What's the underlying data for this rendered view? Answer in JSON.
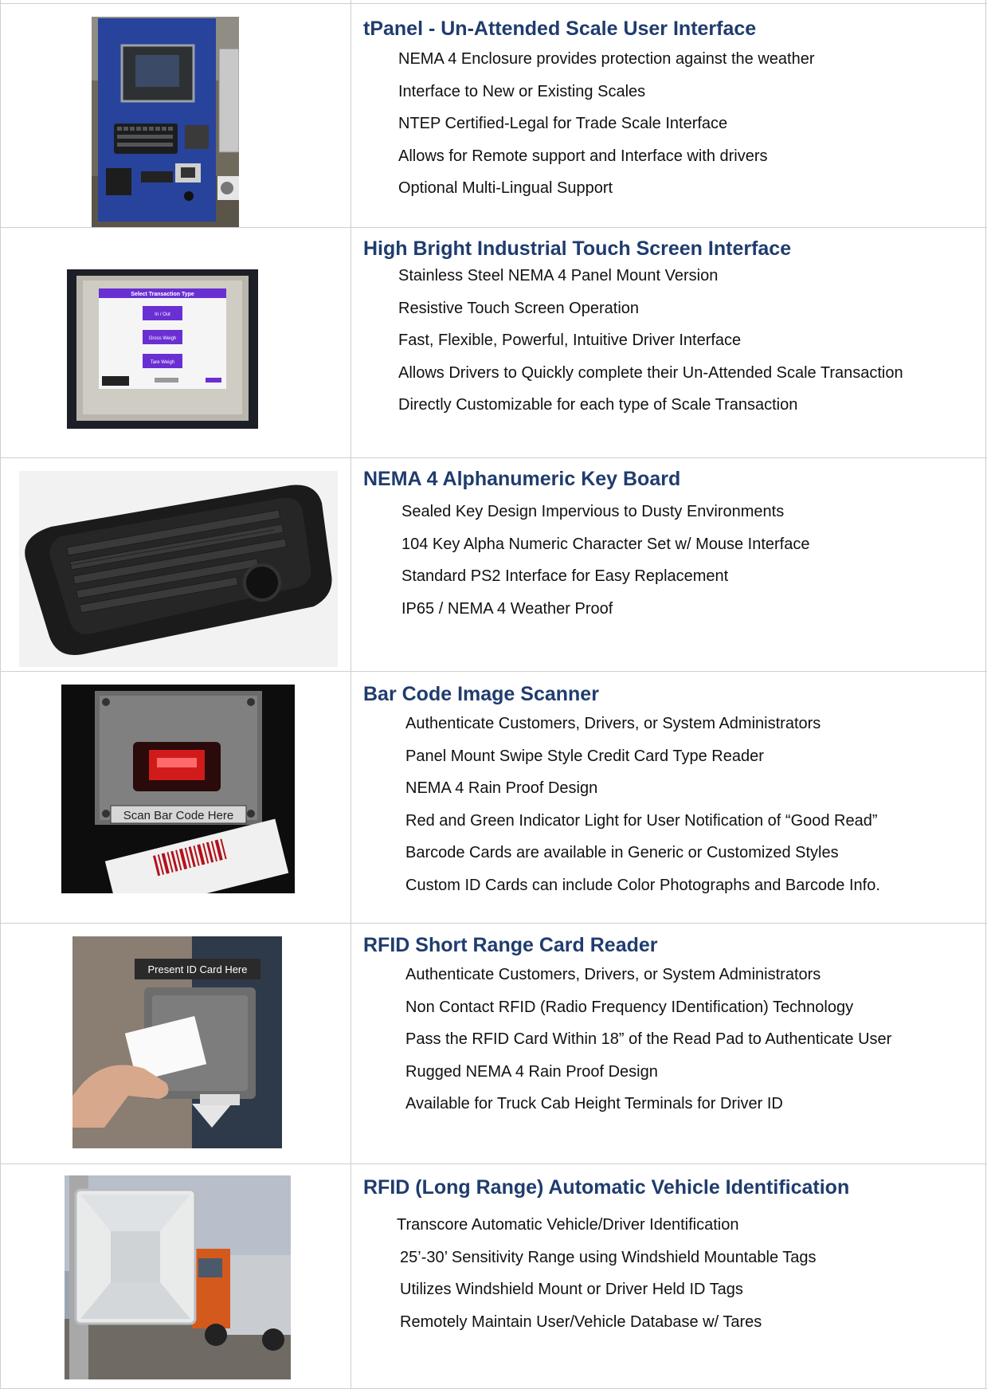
{
  "products": [
    {
      "title": "tPanel - Un-Attended Scale User Interface",
      "image_icon": "kiosk-terminal-photo",
      "bullets": [
        "NEMA 4 Enclosure provides protection against the weather",
        "Interface to New or Existing Scales",
        "NTEP Certified-Legal for Trade Scale Interface",
        "Allows for Remote support and Interface with drivers",
        "Optional Multi-Lingual Support"
      ]
    },
    {
      "title": "High Bright Industrial Touch Screen Interface",
      "image_icon": "touch-screen-photo",
      "screen": {
        "header": "Select Transaction Type",
        "buttons": [
          "In / Out",
          "Gross Weigh",
          "Tare Weigh"
        ]
      },
      "bullets": [
        "Stainless Steel NEMA 4 Panel Mount Version",
        "Resistive Touch Screen Operation",
        "Fast, Flexible, Powerful, Intuitive Driver Interface",
        "Allows Drivers to Quickly complete their Un-Attended Scale Transaction",
        "Directly Customizable for each type of Scale Transaction"
      ]
    },
    {
      "title": "NEMA 4 Alphanumeric Key Board",
      "image_icon": "keyboard-photo",
      "bullets": [
        "Sealed Key Design Impervious to Dusty Environments",
        "104 Key Alpha Numeric Character Set w/ Mouse Interface",
        "Standard PS2 Interface for Easy Replacement",
        "IP65 / NEMA 4 Weather Proof"
      ]
    },
    {
      "title": "Bar Code Image Scanner",
      "image_icon": "barcode-scanner-photo",
      "scanner_label": "Scan Bar Code Here",
      "bullets": [
        "Authenticate Customers, Drivers, or System Administrators",
        "Panel Mount Swipe Style Credit Card Type Reader",
        "NEMA 4 Rain Proof Design",
        "Red and Green Indicator Light for User Notification of “Good Read”",
        "Barcode Cards are available in Generic or Customized Styles",
        "Custom ID Cards can include Color Photographs and Barcode Info."
      ]
    },
    {
      "title": "RFID Short Range Card Reader",
      "image_icon": "rfid-card-reader-photo",
      "reader_label": "Present ID Card Here",
      "bullets": [
        "Authenticate Customers, Drivers, or System Administrators",
        "Non Contact RFID (Radio Frequency IDentification) Technology",
        "Pass the RFID Card Within 18” of the Read Pad to Authenticate User",
        "Rugged NEMA 4 Rain Proof Design",
        "Available for Truck Cab Height Terminals for Driver ID"
      ]
    },
    {
      "title": "RFID (Long Range) Automatic Vehicle Identification",
      "image_icon": "rfid-antenna-truck-photo",
      "bullets": [
        "Transcore Automatic Vehicle/Driver Identification",
        "25’-30’ Sensitivity Range using Windshield Mountable Tags",
        "Utilizes Windshield Mount or Driver Held ID Tags",
        "Remotely Maintain User/Vehicle Database w/ Tares"
      ]
    }
  ],
  "colors": {
    "title": "#1f3c6e",
    "body_text": "#111111",
    "rule": "#cfcfcf"
  }
}
